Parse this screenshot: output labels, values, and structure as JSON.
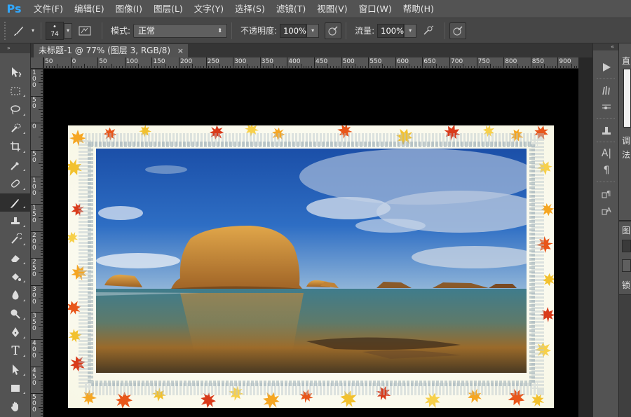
{
  "app": {
    "logo": "Ps"
  },
  "menu": [
    "文件(F)",
    "编辑(E)",
    "图像(I)",
    "图层(L)",
    "文字(Y)",
    "选择(S)",
    "滤镜(T)",
    "视图(V)",
    "窗口(W)",
    "帮助(H)"
  ],
  "options": {
    "brush_size": "74",
    "mode_label": "模式:",
    "mode_value": "正常",
    "opacity_label": "不透明度:",
    "opacity_value": "100%",
    "flow_label": "流量:",
    "flow_value": "100%"
  },
  "toolbar": {
    "collapse": "»"
  },
  "document": {
    "tab_title": "未标题-1 @ 77% (图层 3, RGB/8) *",
    "close": "×"
  },
  "ruler_h": [
    "50",
    "0",
    "50",
    "100",
    "150",
    "200",
    "250",
    "300",
    "350",
    "400",
    "450",
    "500",
    "550",
    "600",
    "650",
    "700",
    "750",
    "800",
    "850",
    "900"
  ],
  "ruler_v": [
    "1\n0\n0",
    "5\n0",
    "0",
    "5\n0",
    "1\n0\n0",
    "1\n5\n0",
    "2\n0\n0",
    "2\n5\n0",
    "3\n0\n0",
    "3\n5\n0",
    "4\n0\n0",
    "4\n5\n0",
    "5\n0\n0"
  ],
  "right_strip": {
    "collapse": "«"
  },
  "right_panel": {
    "labels": [
      "直",
      "调",
      "法",
      "图",
      "锁"
    ]
  },
  "colors": {
    "accent": "#31a8ff",
    "panel": "#535353",
    "canvas_bg": "#000000"
  }
}
